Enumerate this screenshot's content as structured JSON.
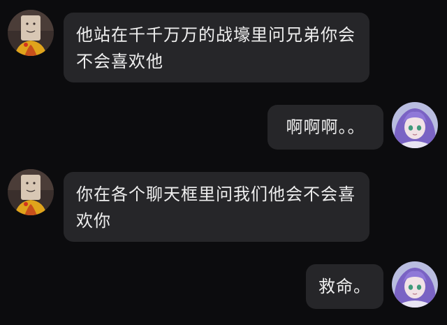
{
  "chat": {
    "messages": [
      {
        "sender": "other",
        "avatar_icon": "paper-bag-mask-avatar-icon",
        "text": "他站在千千万万的战壕里问兄弟你会不会喜欢他"
      },
      {
        "sender": "self",
        "avatar_icon": "anime-purple-hair-avatar-icon",
        "text": "啊啊啊。。"
      },
      {
        "sender": "other",
        "avatar_icon": "paper-bag-mask-avatar-icon",
        "text": "你在各个聊天框里问我们他会不会喜欢你"
      },
      {
        "sender": "self",
        "avatar_icon": "anime-purple-hair-avatar-icon",
        "text": "救命。"
      }
    ]
  },
  "colors": {
    "background": "#0c0c0e",
    "bubble": "#262629",
    "text": "#efefef"
  }
}
